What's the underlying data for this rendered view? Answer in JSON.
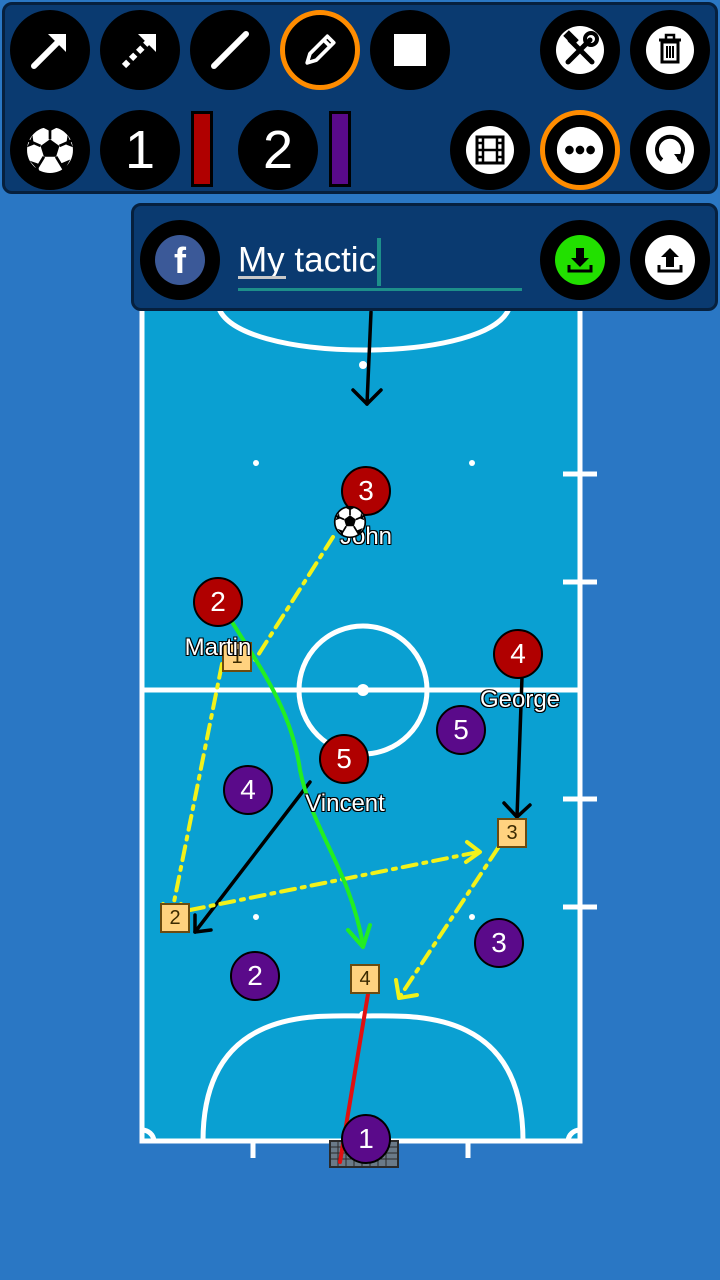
{
  "toolbar": {
    "tools": [
      {
        "name": "arrow-tool",
        "icon": "arrow-icon"
      },
      {
        "name": "dashed-arrow-tool",
        "icon": "dashed-arrow-icon"
      },
      {
        "name": "line-tool",
        "icon": "line-icon"
      },
      {
        "name": "pencil-tool",
        "icon": "pencil-icon"
      },
      {
        "name": "rectangle-tool",
        "icon": "square-icon"
      }
    ],
    "team1_label": "1",
    "team2_label": "2",
    "team1_color": "#b00000",
    "team2_color": "#5a0a8a",
    "selected_color": "#ff8c00"
  },
  "file": {
    "tactic_name": "My tactic",
    "save_color": "#22e000"
  },
  "players": [
    {
      "number": "3",
      "team": 1,
      "name": "John"
    },
    {
      "number": "2",
      "team": 1,
      "name": "Martin"
    },
    {
      "number": "4",
      "team": 1,
      "name": "George"
    },
    {
      "number": "5",
      "team": 1,
      "name": "Vincent"
    },
    {
      "number": "5",
      "team": 2,
      "name": ""
    },
    {
      "number": "4",
      "team": 2,
      "name": ""
    },
    {
      "number": "3",
      "team": 2,
      "name": ""
    },
    {
      "number": "2",
      "team": 2,
      "name": ""
    },
    {
      "number": "1",
      "team": 2,
      "name": ""
    }
  ],
  "markers": [
    "1",
    "2",
    "3",
    "4"
  ],
  "court": {
    "surface_color": "#0aa0d2",
    "line_color": "#ffffff"
  }
}
